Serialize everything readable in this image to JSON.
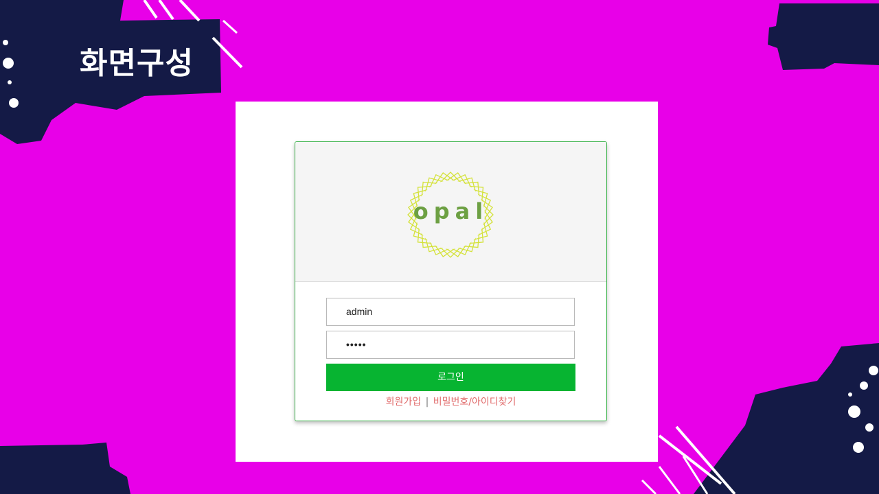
{
  "slide": {
    "title": "화면구성"
  },
  "brand": {
    "logo_text": "opal",
    "logo_color": "#6da043",
    "ring_color": "#d4e23a"
  },
  "login": {
    "username_value": "admin",
    "password_value": "•••••",
    "login_button": "로그인",
    "links": {
      "signup": "회원가입",
      "separator": "|",
      "find": "비밀번호/아이디찾기"
    }
  },
  "colors": {
    "background": "#e800e8",
    "deco_navy": "#141a46",
    "button": "#07b431",
    "card_border": "#3cb44b",
    "link": "#e06a6a"
  }
}
